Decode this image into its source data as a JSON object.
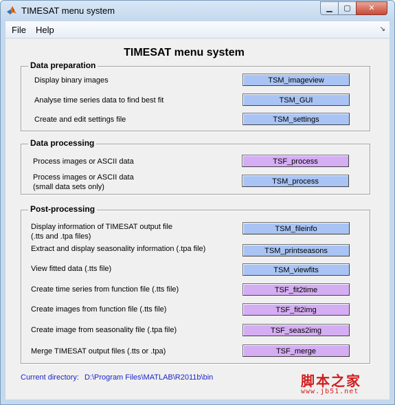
{
  "window": {
    "title": "TIMESAT menu system"
  },
  "controls": {
    "minimize_glyph": "▁",
    "maximize_glyph": "▢",
    "close_glyph": "✕"
  },
  "menubar": {
    "items": [
      {
        "label": "File"
      },
      {
        "label": "Help"
      }
    ],
    "dock_glyph": "↘"
  },
  "main": {
    "title": "TIMESAT menu system"
  },
  "sections": {
    "data_preparation": {
      "title": "Data preparation",
      "rows": [
        {
          "label": "Display binary images",
          "button": "TSM_imageview",
          "color": "blue"
        },
        {
          "label": "Analyse time series data to find best fit",
          "button": "TSM_GUI",
          "color": "blue"
        },
        {
          "label": "Create and edit settings file",
          "button": "TSM_settings",
          "color": "blue"
        }
      ]
    },
    "data_processing": {
      "title": "Data processing",
      "rows": [
        {
          "label": "Process images or ASCII data",
          "button": "TSF_process",
          "color": "purple"
        },
        {
          "label": "Process images or ASCII data",
          "label2": "(small data sets only)",
          "button": "TSM_process",
          "color": "blue"
        }
      ]
    },
    "post_processing": {
      "title": "Post-processing",
      "rows": [
        {
          "label": "Display information of TIMESAT output file",
          "label2": "(.tts and .tpa files)",
          "button": "TSM_fileinfo",
          "color": "blue"
        },
        {
          "label": "Extract and display seasonality information (.tpa file)",
          "button": "TSM_printseasons",
          "color": "blue"
        },
        {
          "label": "View fitted data (.tts file)",
          "button": "TSM_viewfits",
          "color": "blue"
        },
        {
          "label": "Create time series from function file (.tts file)",
          "button": "TSF_fit2time",
          "color": "purple"
        },
        {
          "label": "Create images from function file (.tts file)",
          "button": "TSF_fit2img",
          "color": "purple"
        },
        {
          "label": "Create image from seasonality file (.tpa file)",
          "button": "TSF_seas2img",
          "color": "purple"
        },
        {
          "label": "Merge TIMESAT output files (.tts or .tpa)",
          "button": "TSF_merge",
          "color": "purple"
        }
      ]
    }
  },
  "status": {
    "current_dir_label": "Current directory:",
    "current_dir_value": "D:\\Program Files\\MATLAB\\R2011b\\bin"
  },
  "watermark": {
    "main": "脚本之家",
    "sub": "www.jb51.net"
  },
  "colors": {
    "button_blue": "#a9c4f4",
    "button_purple": "#d5adf2",
    "current_dir_text": "#1d23c8"
  }
}
